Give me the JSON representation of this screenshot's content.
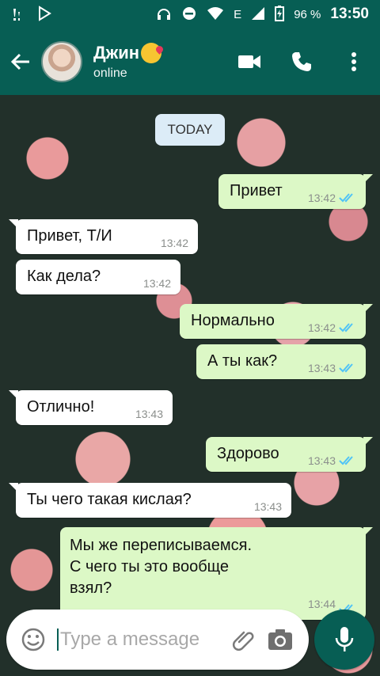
{
  "statusbar": {
    "battery_percent": "96 %",
    "network_letter": "E",
    "time": "13:50"
  },
  "header": {
    "contact_name": "Джин",
    "contact_status": "online",
    "name_emoji": "kissing-face-icon",
    "actions": [
      "video-call-icon",
      "phone-icon",
      "more-vert-icon"
    ]
  },
  "chat": {
    "date_chip": "TODAY",
    "messages": [
      {
        "dir": "out",
        "text": "Привет",
        "time": "13:42",
        "status": "read"
      },
      {
        "dir": "in",
        "text": "Привет, Т/И",
        "time": "13:42"
      },
      {
        "dir": "in",
        "text": "Как дела?",
        "time": "13:42"
      },
      {
        "dir": "out",
        "text": "Нормально",
        "time": "13:42",
        "status": "read"
      },
      {
        "dir": "out",
        "text": "А ты как?",
        "time": "13:43",
        "status": "read"
      },
      {
        "dir": "in",
        "text": "Отлично!",
        "time": "13:43"
      },
      {
        "dir": "out",
        "text": "Здорово",
        "time": "13:43",
        "status": "read"
      },
      {
        "dir": "in",
        "text": "Ты чего такая кислая?",
        "time": "13:43"
      },
      {
        "dir": "out",
        "text": "Мы же переписываемся. С чего ты это вообще взял?",
        "lines": [
          "Мы же переписываемся.",
          "С чего ты это вообще",
          "взял?"
        ],
        "time": "13:44",
        "status": "read"
      }
    ]
  },
  "composer": {
    "placeholder": "Type a message"
  },
  "colors": {
    "header": "#075e54",
    "outgoing_bubble": "#dcf8c6",
    "incoming_bubble": "#ffffff",
    "read_ticks": "#4fc3f7"
  }
}
